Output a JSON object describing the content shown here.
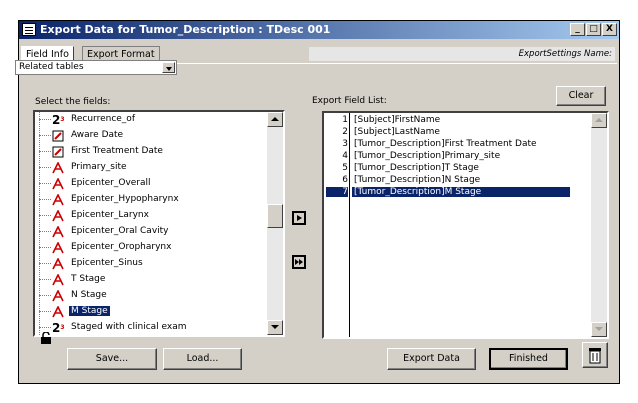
{
  "window": {
    "title": "Export Data for Tumor_Description : TDesc 001",
    "controls": [
      "_",
      "□",
      "X"
    ]
  },
  "tabs": [
    {
      "label": "Field Info",
      "active": true
    },
    {
      "label": "Export Format",
      "active": false
    }
  ],
  "settings_label": "ExportSettings Name:",
  "left": {
    "dropdown_value": "Related tables",
    "select_label": "Select the fields:",
    "fields": [
      {
        "label": "Recurrence_of",
        "icon": "numeric-icon",
        "selected": false
      },
      {
        "label": "Aware Date",
        "icon": "date-icon",
        "selected": false
      },
      {
        "label": "First Treatment Date",
        "icon": "date-icon",
        "selected": false
      },
      {
        "label": "Primary_site",
        "icon": "text-icon",
        "selected": false
      },
      {
        "label": "Epicenter_Overall",
        "icon": "text-icon",
        "selected": false
      },
      {
        "label": "Epicenter_Hypopharynx",
        "icon": "text-icon",
        "selected": false
      },
      {
        "label": "Epicenter_Larynx",
        "icon": "text-icon",
        "selected": false
      },
      {
        "label": "Epicenter_Oral Cavity",
        "icon": "text-icon",
        "selected": false
      },
      {
        "label": "Epicenter_Oropharynx",
        "icon": "text-icon",
        "selected": false
      },
      {
        "label": "Epicenter_Sinus",
        "icon": "text-icon",
        "selected": false
      },
      {
        "label": "T Stage",
        "icon": "text-icon",
        "selected": false
      },
      {
        "label": "N Stage",
        "icon": "text-icon",
        "selected": false
      },
      {
        "label": "M Stage",
        "icon": "text-icon",
        "selected": true
      },
      {
        "label": "Staged with clinical exam",
        "icon": "numeric-icon",
        "selected": false
      }
    ]
  },
  "right": {
    "label": "Export Field List:",
    "clear_label": "Clear",
    "items": [
      {
        "num": "1",
        "label": "[Subject]FirstName",
        "selected": false
      },
      {
        "num": "2",
        "label": "[Subject]LastName",
        "selected": false
      },
      {
        "num": "3",
        "label": "[Tumor_Description]First Treatment Date",
        "selected": false
      },
      {
        "num": "4",
        "label": "[Tumor_Description]Primary_site",
        "selected": false
      },
      {
        "num": "5",
        "label": "[Tumor_Description]T Stage",
        "selected": false
      },
      {
        "num": "6",
        "label": "[Tumor_Description]N Stage",
        "selected": false
      },
      {
        "num": "7",
        "label": "[Tumor_Description]M Stage",
        "selected": true
      }
    ]
  },
  "footer": {
    "save_label": "Save...",
    "load_label": "Load...",
    "export_label": "Export Data",
    "finished_label": "Finished"
  }
}
